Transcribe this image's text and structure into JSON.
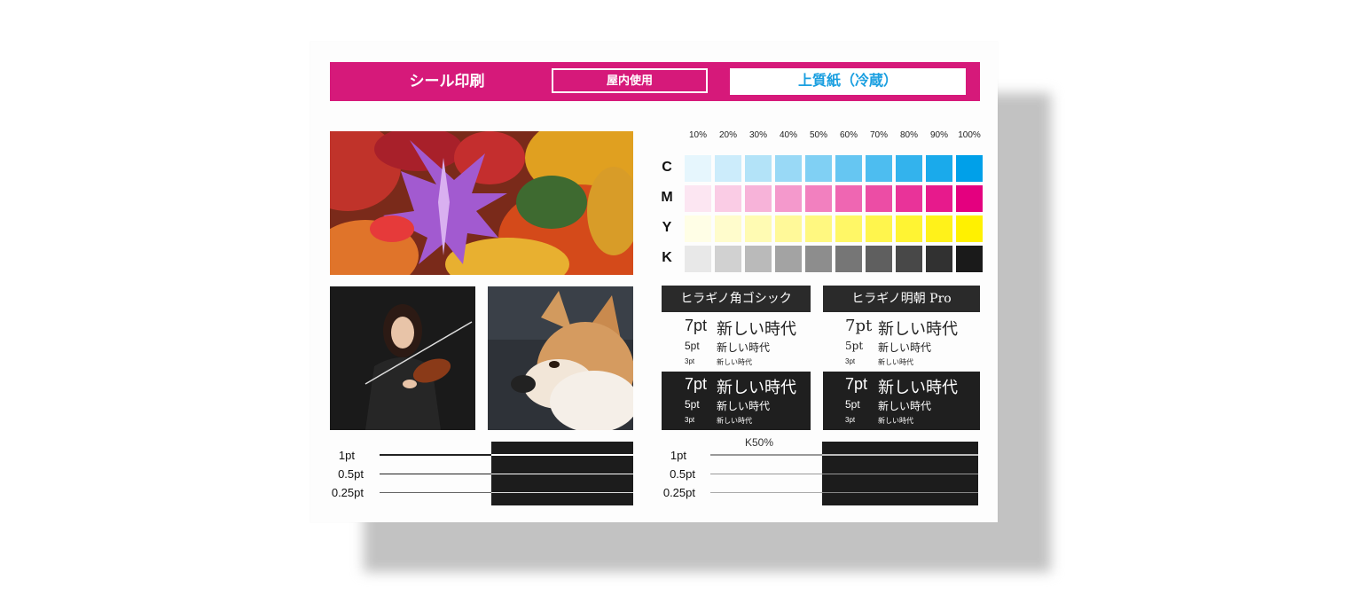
{
  "header": {
    "title": "シール印刷",
    "usage": "屋内使用",
    "paper": "上質紙（冷蔵）",
    "accent": "#d6197a",
    "paper_color": "#1a9fe0"
  },
  "photos": {
    "leaves": "autumn-leaves-photo",
    "violinist": "violinist-photo",
    "dog": "shiba-dog-photo"
  },
  "color_chart": {
    "percentages": [
      "10%",
      "20%",
      "30%",
      "40%",
      "50%",
      "60%",
      "70%",
      "80%",
      "90%",
      "100%"
    ],
    "rows": [
      {
        "label": "C",
        "base": "#00a0e9"
      },
      {
        "label": "M",
        "base": "#e4007f"
      },
      {
        "label": "Y",
        "base": "#fff100"
      },
      {
        "label": "K",
        "base": "#1a1a1a"
      }
    ]
  },
  "fonts": {
    "gothic_name": "ヒラギノ角ゴシック",
    "mincho_name": "ヒラギノ明朝 Pro",
    "sample_text": "新しい時代",
    "size_7": "7pt",
    "size_5": "5pt",
    "size_3": "3pt"
  },
  "lines": {
    "labels": [
      "1pt",
      "0.5pt",
      "0.25pt"
    ],
    "k50_label": "K50%"
  }
}
